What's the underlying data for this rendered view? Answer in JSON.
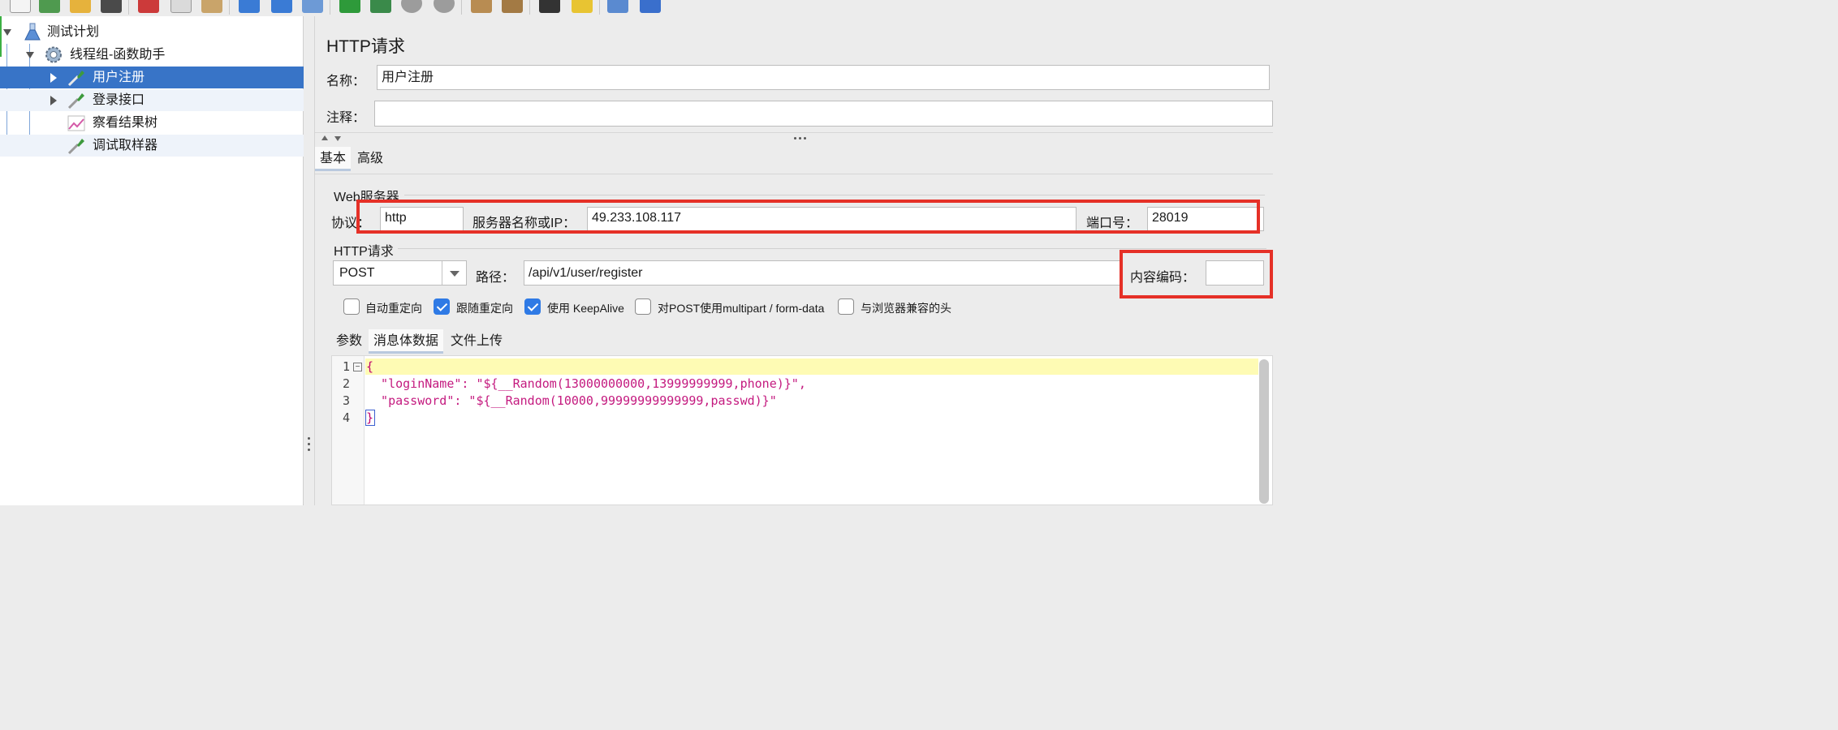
{
  "toolbar": {
    "icons": [
      "new-icon",
      "templates-icon",
      "open-icon",
      "save-icon",
      "cut-icon",
      "copy-icon",
      "paste-icon",
      "expand-icon",
      "collapse-icon",
      "toggle-icon",
      "start-icon",
      "start-no-pause-icon",
      "stop-icon",
      "shutdown-icon",
      "clear-icon",
      "clear-all-icon",
      "search-icon",
      "reset-search-icon",
      "function-helper-icon",
      "help-icon"
    ]
  },
  "tree": {
    "items": [
      {
        "label": "测试计划",
        "icon": "test-plan-flask-icon"
      },
      {
        "label": "线程组-函数助手",
        "icon": "thread-group-gear-icon"
      },
      {
        "label": "用户注册",
        "icon": "http-sampler-pipette-icon"
      },
      {
        "label": "登录接口",
        "icon": "http-sampler-pipette-icon"
      },
      {
        "label": "察看结果树",
        "icon": "results-tree-chart-icon"
      },
      {
        "label": "调试取样器",
        "icon": "debug-sampler-pipette-icon"
      }
    ]
  },
  "panel": {
    "title": "HTTP请求",
    "name_label": "名称：",
    "name_value": "用户注册",
    "comment_label": "注释：",
    "comment_value": ""
  },
  "tabs": {
    "basic": "基本",
    "advanced": "高级"
  },
  "web_server": {
    "group_title": "Web服务器",
    "protocol_label": "协议：",
    "protocol_value": "http",
    "server_label": "服务器名称或IP：",
    "server_value": "49.233.108.117",
    "port_label": "端口号：",
    "port_value": "28019"
  },
  "http_request": {
    "group_title": "HTTP请求",
    "method": "POST",
    "path_label": "路径：",
    "path_value": "/api/v1/user/register",
    "encoding_label": "内容编码：",
    "encoding_value": ""
  },
  "options": [
    {
      "label": "自动重定向",
      "checked": false
    },
    {
      "label": "跟随重定向",
      "checked": true
    },
    {
      "label": "使用 KeepAlive",
      "checked": true
    },
    {
      "label": "对POST使用multipart / form-data",
      "checked": false
    },
    {
      "label": "与浏览器兼容的头",
      "checked": false
    }
  ],
  "subtabs": {
    "params": "参数",
    "body": "消息体数据",
    "files": "文件上传"
  },
  "editor": {
    "line_numbers": [
      "1",
      "2",
      "3",
      "4"
    ],
    "lines": [
      "{",
      "  \"loginName\": \"${__Random(13000000000,13999999999,phone)}\",",
      "  \"password\": \"${__Random(10000,99999999999999,passwd)}\"",
      "}"
    ]
  },
  "colors": {
    "selection": "#3874c7",
    "highlight_box": "#e53027",
    "checkbox_on": "#2f7ae5",
    "json_string": "#e0127e"
  }
}
